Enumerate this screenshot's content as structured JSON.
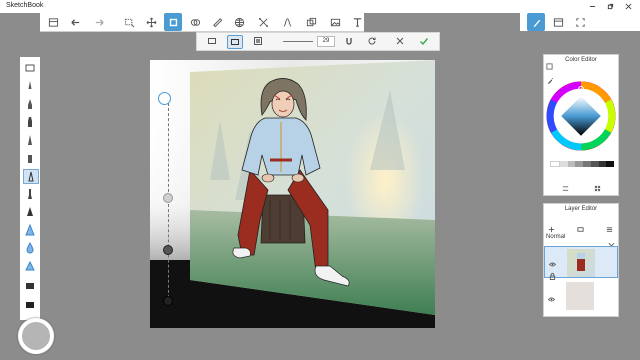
{
  "window": {
    "title": "SketchBook"
  },
  "subbar": {
    "size_value": "29"
  },
  "color_editor": {
    "title": "Color Editor"
  },
  "layer_editor": {
    "title": "Layer Editor",
    "blend_mode": "Normal"
  },
  "colors": {
    "accent": "#4a9bd4",
    "jacket": "#b7d2e6",
    "pants": "#9a2d1f",
    "hair": "#7d7464",
    "ground": "#4a8a5a"
  }
}
